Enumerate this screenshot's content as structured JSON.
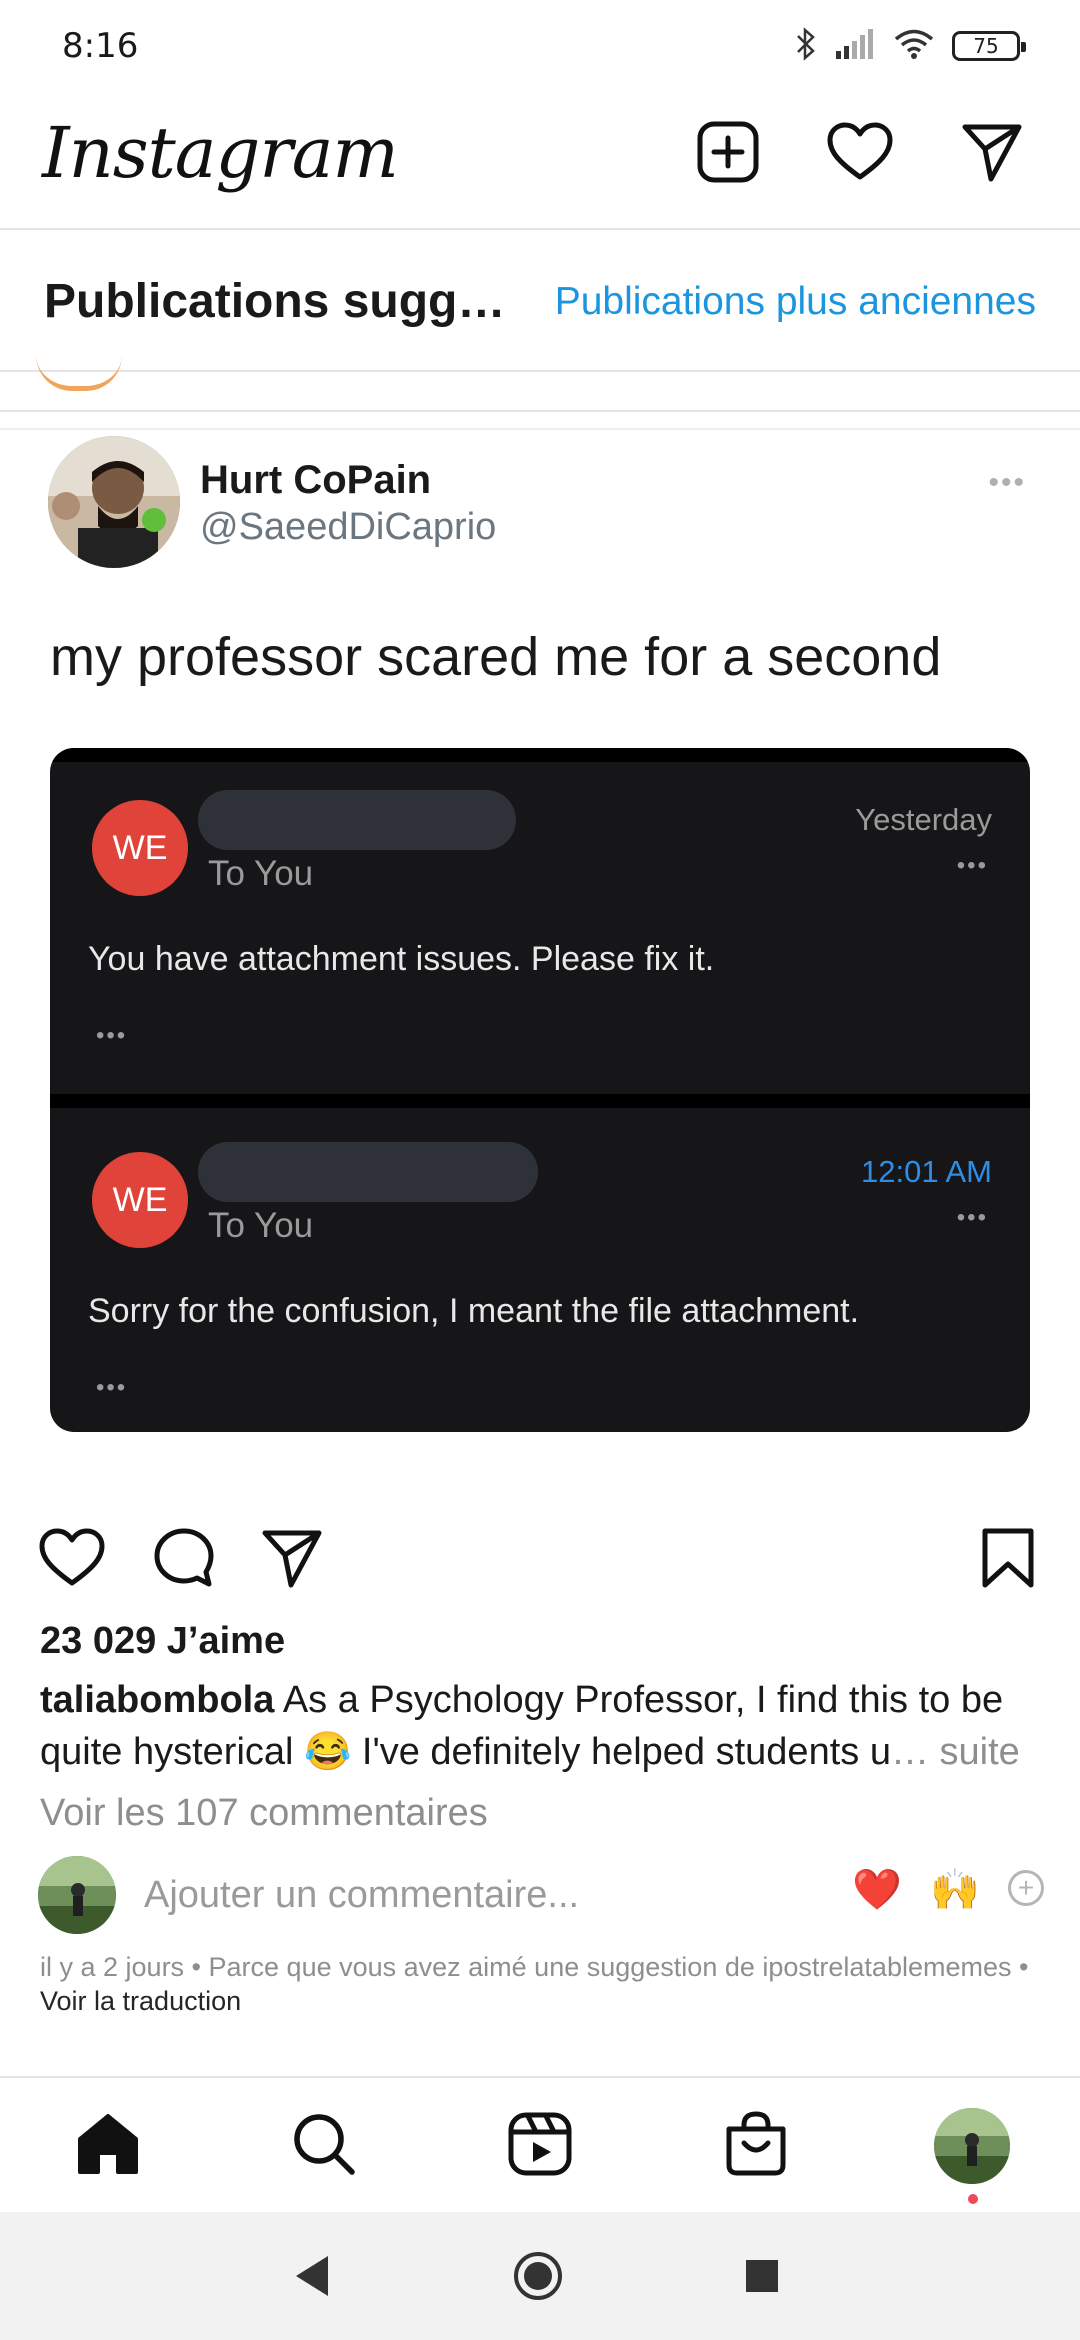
{
  "status_bar": {
    "time": "8:16",
    "battery": "75"
  },
  "header": {
    "logo": "Instagram"
  },
  "banner": {
    "title": "Publications sugg…",
    "link": "Publications plus anciennes"
  },
  "post": {
    "author_name": "Hurt CoPain",
    "author_handle": "@SaeedDiCaprio",
    "more": "•••",
    "text": "my professor scared me for a second",
    "emails": [
      {
        "avatar": "WE",
        "to": "To You",
        "date": "Yesterday",
        "date_color": "#9a9a9a",
        "dots": "•••",
        "body": "You have attachment issues. Please fix it.",
        "footer_dots": "•••"
      },
      {
        "avatar": "WE",
        "to": "To You",
        "date": "12:01 AM",
        "date_color": "#2e8de6",
        "dots": "•••",
        "body": "Sorry for the confusion, I meant the file attachment.",
        "footer_dots": "•••"
      }
    ]
  },
  "engagement": {
    "likes": "23 029 J’aime",
    "caption_user": "taliabombola",
    "caption_text_1": " As a Psychology Professor, I find this to be quite hysterical ",
    "caption_emoji": "😂",
    "caption_text_2": " I've definitely helped students u",
    "caption_more": "… suite",
    "view_comments": "Voir les 107 commentaires"
  },
  "comment": {
    "placeholder": "Ajouter un commentaire...",
    "quick_reactions": [
      "❤️",
      "🙌"
    ],
    "add_reaction": "+"
  },
  "meta": {
    "text": "il y a 2 jours • Parce que vous avez aimé une suggestion de ipostrelatablememes • ",
    "translate": "Voir la traduction"
  },
  "icons": {
    "new_post": "plus-square-icon",
    "activity": "heart-icon",
    "messages": "send-icon",
    "like": "heart-icon",
    "comment": "comment-icon",
    "share": "send-icon",
    "save": "bookmark-icon",
    "home": "home-icon",
    "search": "search-icon",
    "reels": "reels-icon",
    "shop": "shop-icon"
  },
  "colors": {
    "accent_blue": "#1b95e0",
    "notification_red": "#ed4956",
    "we_avatar": "#e0433a"
  }
}
